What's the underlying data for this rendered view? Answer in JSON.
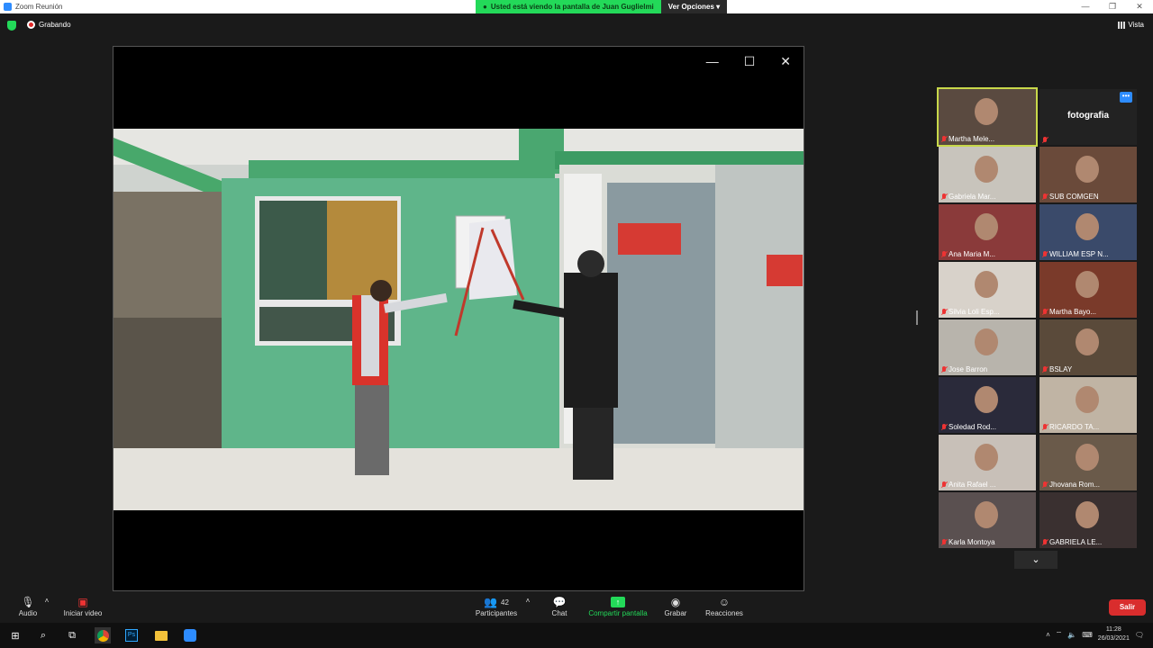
{
  "window": {
    "title": "Zoom Reunión"
  },
  "share_banner": {
    "text": "Usted está viendo la pantalla de Juan Guglielmi",
    "options_label": "Ver Opciones"
  },
  "topbar": {
    "recording_label": "Grabando",
    "view_label": "Vista"
  },
  "participants": [
    {
      "name": "Martha Mele...",
      "kind": "video",
      "active": true
    },
    {
      "name": "fotografia",
      "kind": "name-only"
    },
    {
      "name": "Gabriela Mar...",
      "kind": "video"
    },
    {
      "name": "SUB COMGEN",
      "kind": "video"
    },
    {
      "name": "Ana Maria M...",
      "kind": "video"
    },
    {
      "name": "WILLIAM ESP N...",
      "kind": "video"
    },
    {
      "name": "Silvia Loli Esp...",
      "kind": "video"
    },
    {
      "name": "Martha Bayo...",
      "kind": "video"
    },
    {
      "name": "Jose Barron",
      "kind": "video"
    },
    {
      "name": "BSLAY",
      "kind": "video"
    },
    {
      "name": "Soledad Rod...",
      "kind": "video"
    },
    {
      "name": "RICARDO TA...",
      "kind": "video"
    },
    {
      "name": "Anita Rafael ...",
      "kind": "video"
    },
    {
      "name": "Jhovana Rom...",
      "kind": "video"
    },
    {
      "name": "Karla Montoya",
      "kind": "video"
    },
    {
      "name": "GABRIELA LE...",
      "kind": "video"
    }
  ],
  "toolbar": {
    "audio_label": "Audio",
    "video_label": "Iniciar video",
    "participants_label": "Participantes",
    "participants_count": "42",
    "chat_label": "Chat",
    "share_label": "Compartir pantalla",
    "record_label": "Grabar",
    "reactions_label": "Reacciones",
    "leave_label": "Salir"
  },
  "taskbar": {
    "time": "11:28",
    "date": "26/03/2021"
  },
  "colors": {
    "accent_green": "#23d959",
    "zoom_blue": "#2d8cff",
    "leave_red": "#d92d2d"
  }
}
